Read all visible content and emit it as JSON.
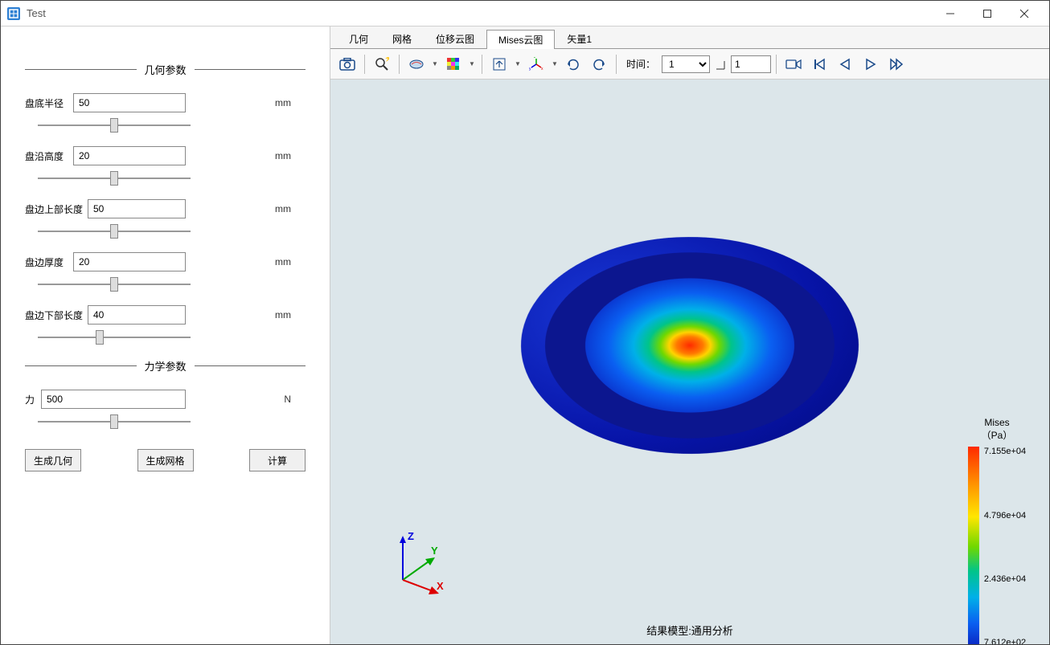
{
  "window": {
    "title": "Test"
  },
  "sidebar": {
    "sections": {
      "geometry": {
        "title": "几何参数"
      },
      "mechanics": {
        "title": "力学参数"
      }
    },
    "params": {
      "disc_bottom_radius": {
        "label": "盘底半径",
        "value": "50",
        "unit": "mm"
      },
      "rim_height": {
        "label": "盘沿高度",
        "value": "20",
        "unit": "mm"
      },
      "edge_upper_length": {
        "label": "盘边上部长度",
        "value": "50",
        "unit": "mm"
      },
      "edge_thickness": {
        "label": "盘边厚度",
        "value": "20",
        "unit": "mm"
      },
      "edge_lower_length": {
        "label": "盘边下部长度",
        "value": "40",
        "unit": "mm"
      },
      "force": {
        "label": "力",
        "value": "500",
        "unit": "N"
      }
    },
    "buttons": {
      "generate_geometry": "生成几何",
      "generate_mesh": "生成网格",
      "compute": "计算"
    }
  },
  "tabs": {
    "geometry": "几何",
    "mesh": "网格",
    "displacement": "位移云图",
    "mises": "Mises云图",
    "vector1": "矢量1"
  },
  "toolbar": {
    "time_label": "时间：",
    "time_select_value": "1",
    "frame_input_value": "1"
  },
  "viewport": {
    "axes": {
      "x": "X",
      "y": "Y",
      "z": "Z"
    },
    "legend": {
      "title_line1": "Mises",
      "title_line2": "（Pa）",
      "ticks": [
        "7.155e+04",
        "4.796e+04",
        "2.436e+04",
        "7.612e+02"
      ]
    },
    "status": "结果模型:通用分析"
  }
}
